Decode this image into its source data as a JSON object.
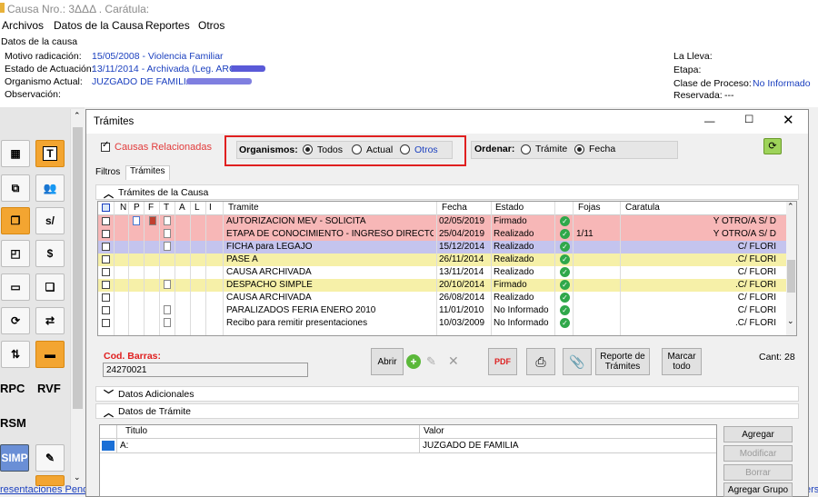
{
  "window": {
    "title": "Causa Nro.: 3ΔΔΔ . Carátula:"
  },
  "menu": [
    "Archivos",
    "Datos de la Causa",
    "Reportes",
    "Otros"
  ],
  "causa": {
    "section_title": "Datos de la causa",
    "motivo_label": "Motivo radicación:",
    "motivo_value": "15/05/2008 - Violencia Familiar",
    "estado_label": "Estado de Actuación:",
    "estado_value": "13/11/2014 - Archivada (Leg. ARC",
    "organismo_label": "Organismo Actual:",
    "organismo_value": "JUZGADO DE FAMILIA",
    "observacion_label": "Observación:",
    "lleva_label": "La Lleva:",
    "etapa_label": "Etapa:",
    "clase_label": "Clase de Proceso:",
    "clase_value": "No Informado",
    "reservada_label": "Reservada:",
    "reservada_value": "---"
  },
  "toolbar": {
    "rpc": "RPC",
    "rvf": "RVF",
    "rsm": "RSM",
    "simp": "SIMP",
    "t": "T",
    "s": "s/"
  },
  "bottom_link": "resentaciones Pendie",
  "bottom_right": "ers",
  "dialog": {
    "title": "Trámites",
    "causas_relacionadas": "Causas Relacionadas",
    "organismos_label": "Organismos:",
    "org_todos": "Todos",
    "org_actual": "Actual",
    "org_otros": "Otros",
    "ordenar_label": "Ordenar:",
    "ord_tramite": "Trámite",
    "ord_fecha": "Fecha",
    "tab_filtros": "Filtros",
    "tab_tramites": "Trámites",
    "section_tramites": "Trámites de la Causa",
    "section_adicionales": "Datos Adicionales",
    "section_datos_tramite": "Datos de Trámite",
    "cod_barras_label": "Cod. Barras:",
    "cod_barras_value": "24270021",
    "cant": "Cant: 28",
    "btn_abrir": "Abrir",
    "btn_reporte": "Reporte de Trámites",
    "btn_marcar": "Marcar todo",
    "btn_agregar": "Agregar",
    "btn_modificar": "Modificar",
    "btn_borrar": "Borrar",
    "btn_agregar_grupo": "Agregar Grupo"
  },
  "grid": {
    "headers": [
      "N",
      "P",
      "F",
      "T",
      "A",
      "L",
      "I",
      "Tramite",
      "Fecha",
      "Estado",
      "Fojas",
      "Caratula"
    ],
    "rows": [
      {
        "tramite": "AUTORIZACION MEV - SOLICITA",
        "fecha": "02/05/2019",
        "estado": "Firmado",
        "fojas": "",
        "caratula": "Y OTRO/A S/ D",
        "color": "#f7b7b7"
      },
      {
        "tramite": "ETAPA DE CONOCIMIENTO - INGRESO DIRECTO",
        "fecha": "25/04/2019",
        "estado": "Realizado",
        "fojas": "1/11",
        "caratula": "Y OTRO/A S/ D",
        "color": "#f7b7b7"
      },
      {
        "tramite": "FICHA para LEGAJO",
        "fecha": "15/12/2014",
        "estado": "Realizado",
        "fojas": "",
        "caratula": "C/        FLORI",
        "color": "#c4c4ee"
      },
      {
        "tramite": "PASE A",
        "fecha": "26/11/2014",
        "estado": "Realizado",
        "fojas": "",
        "caratula": ".C/        FLORI",
        "color": "#f6f0a8"
      },
      {
        "tramite": "CAUSA ARCHIVADA",
        "fecha": "13/11/2014",
        "estado": "Realizado",
        "fojas": "",
        "caratula": "C/        FLORI",
        "color": "#ffffff"
      },
      {
        "tramite": "DESPACHO SIMPLE",
        "fecha": "20/10/2014",
        "estado": "Firmado",
        "fojas": "",
        "caratula": ".C/        FLORI",
        "color": "#f6f0a8"
      },
      {
        "tramite": "CAUSA ARCHIVADA",
        "fecha": "26/08/2014",
        "estado": "Realizado",
        "fojas": "",
        "caratula": "C/        FLORI",
        "color": "#ffffff"
      },
      {
        "tramite": "PARALIZADOS FERIA ENERO 2010",
        "fecha": "11/01/2010",
        "estado": "No Informado",
        "fojas": "",
        "caratula": "C/        FLORI",
        "color": "#ffffff"
      },
      {
        "tramite": "Recibo para remitir presentaciones",
        "fecha": "10/03/2009",
        "estado": "No Informado",
        "fojas": "",
        "caratula": ".C/        FLORI",
        "color": "#ffffff"
      }
    ]
  },
  "datos_tramite": {
    "headers": [
      "Titulo",
      "Valor"
    ],
    "row": {
      "titulo": "A:",
      "valor": "JUZGADO DE FAMILIA"
    }
  }
}
